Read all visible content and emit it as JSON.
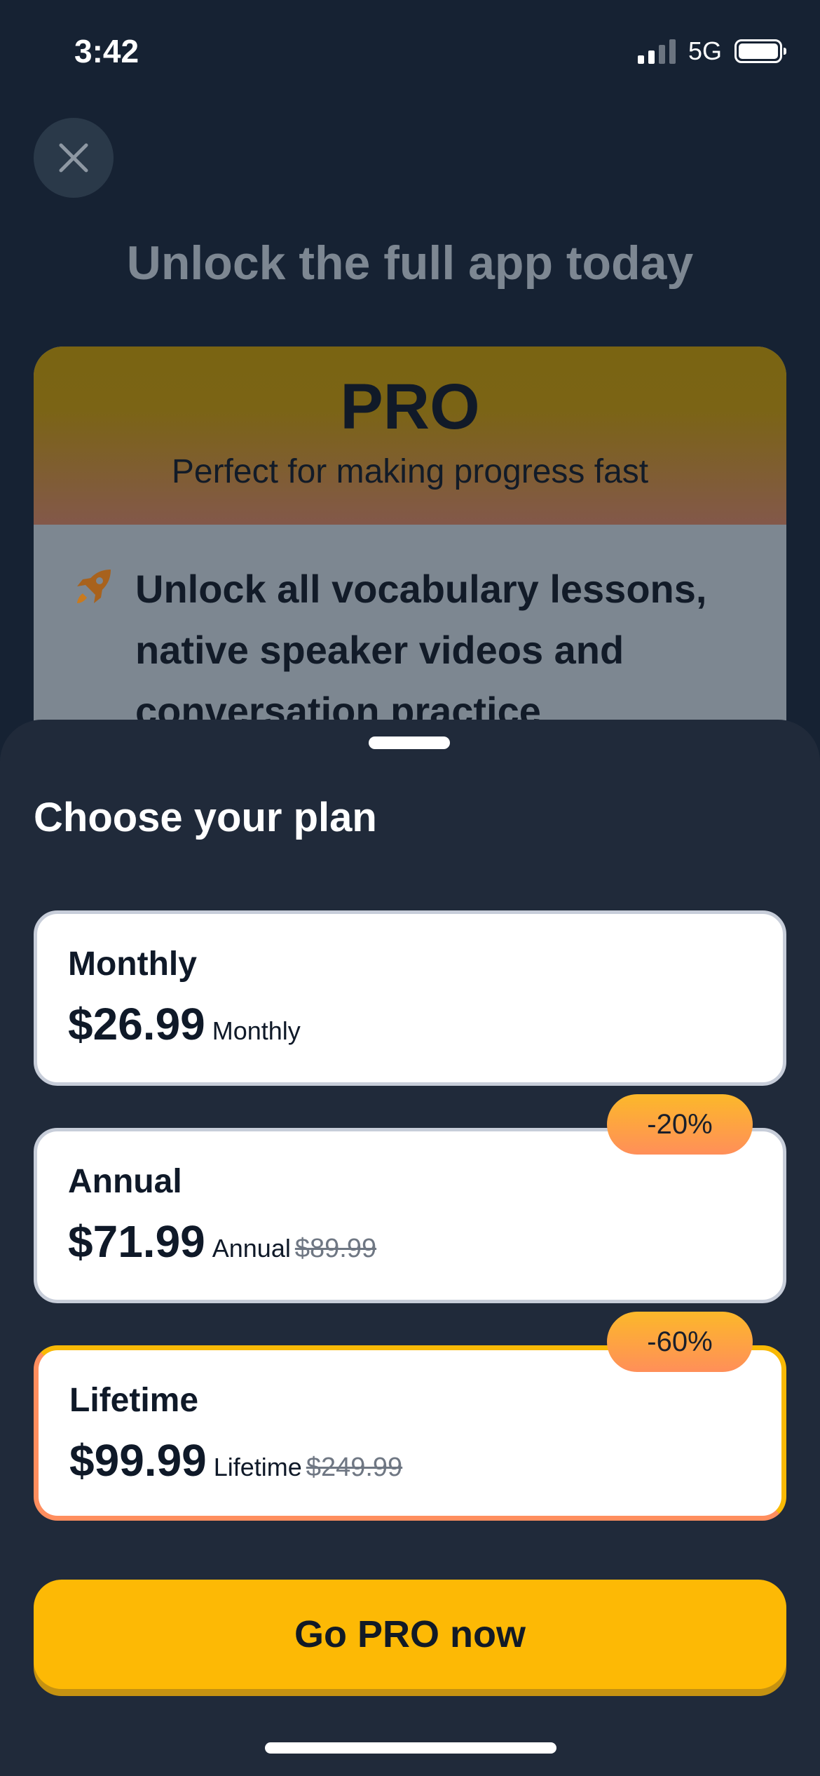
{
  "status_bar": {
    "time": "3:42",
    "network": "5G"
  },
  "background": {
    "title": "Unlock the full app today",
    "pro_card": {
      "title": "PRO",
      "subtitle": "Perfect for making progress fast",
      "feature_lines": [
        "Unlock all vocabulary lessons,",
        "native speaker videos and",
        "conversation practice"
      ]
    }
  },
  "sheet": {
    "title": "Choose your plan",
    "plans": [
      {
        "name": "Monthly",
        "price": "$26.99",
        "period": "Monthly",
        "old_price": "",
        "badge": ""
      },
      {
        "name": "Annual",
        "price": "$71.99",
        "period": "Annual",
        "old_price": "$89.99",
        "badge": "-20%"
      },
      {
        "name": "Lifetime",
        "price": "$99.99",
        "period": "Lifetime",
        "old_price": "$249.99",
        "badge": "-60%",
        "selected": true
      }
    ],
    "cta_label": "Go PRO now"
  },
  "colors": {
    "accent": "#fdb905",
    "badge_gradient_end": "#ff8f59",
    "sheet_bg": "#202a3a",
    "page_bg": "#162233"
  },
  "icons": {
    "close": "close-icon",
    "feature": "rocket-icon",
    "signal": "signal-icon",
    "battery": "battery-icon"
  }
}
